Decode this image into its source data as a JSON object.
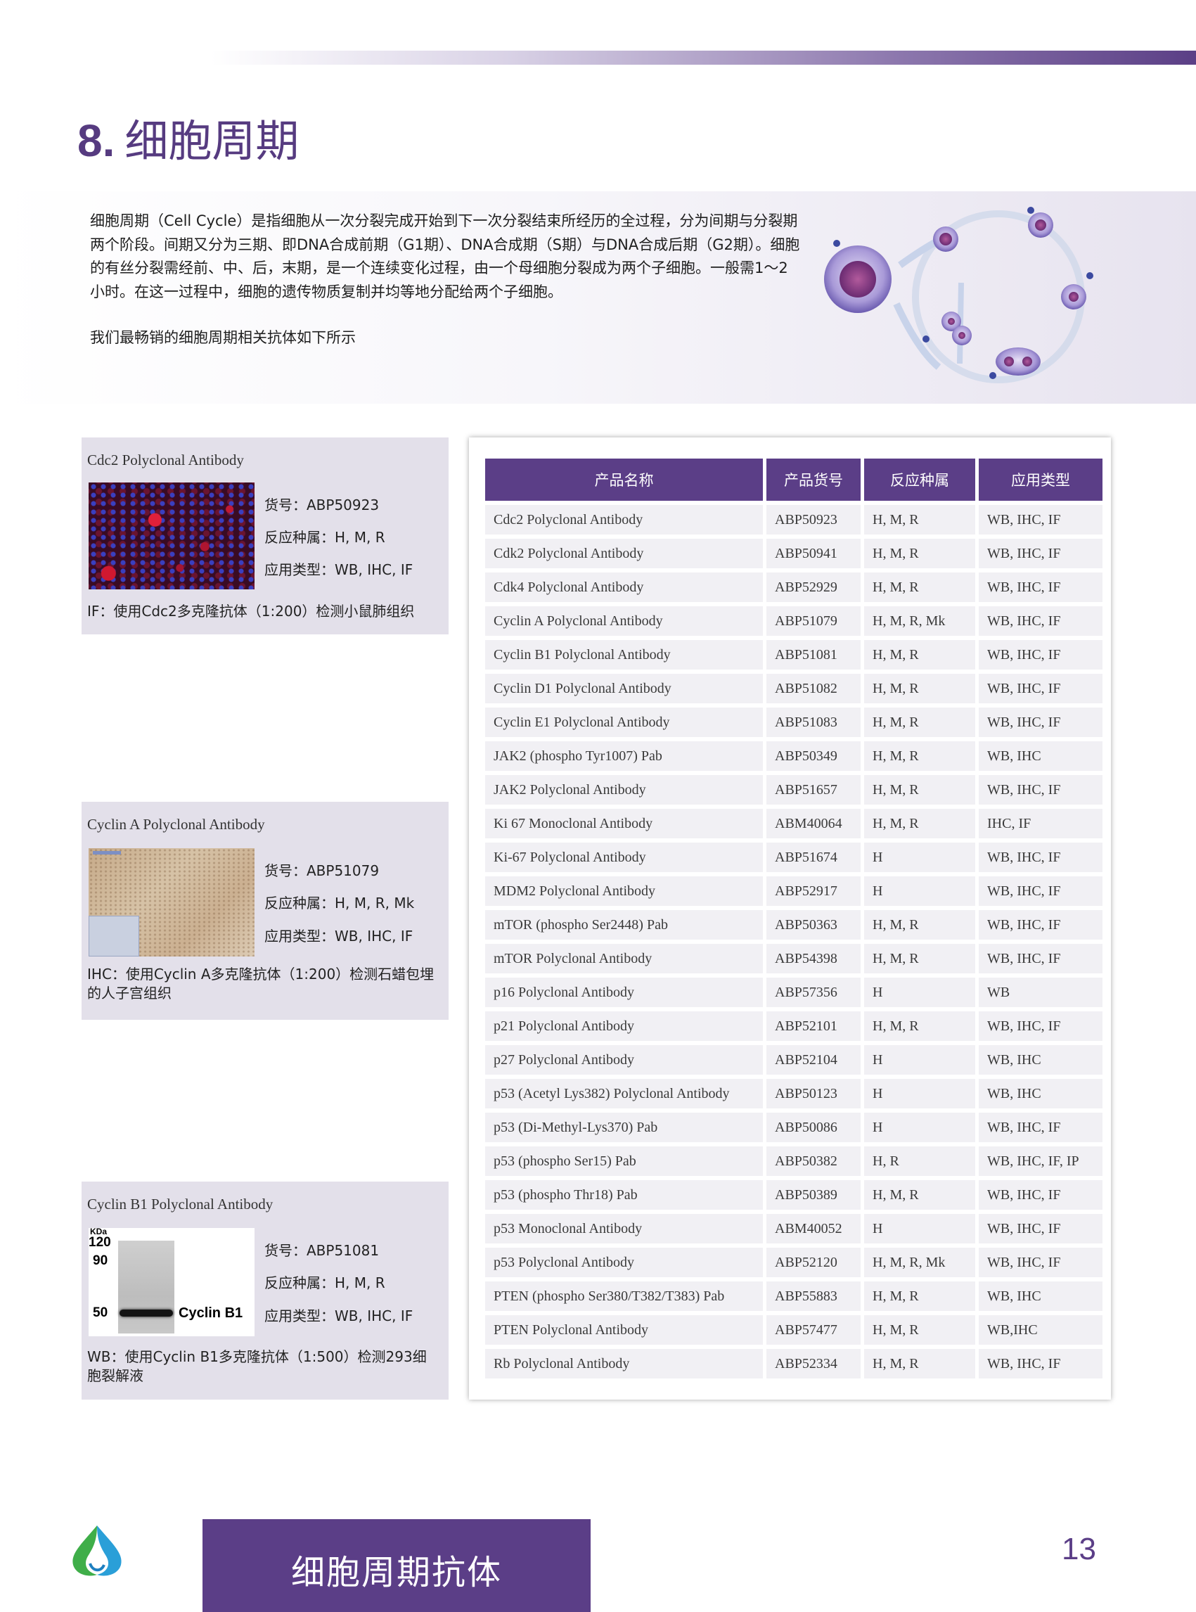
{
  "header": {
    "section_number": "8.",
    "title": "细胞周期"
  },
  "intro": {
    "paragraph": "细胞周期（Cell Cycle）是指细胞从一次分裂完成开始到下一次分裂结束所经历的全过程，分为间期与分裂期两个阶段。间期又分为三期、即DNA合成前期（G1期）、DNA合成期（S期）与DNA合成后期（G2期）。细胞的有丝分裂需经前、中、后，末期，是一个连续变化过程，由一个母细胞分裂成为两个子细胞。一般需1～2小时。在这一过程中，细胞的遗传物质复制并均等地分配给两个子细胞。",
    "note": "我们最畅销的细胞周期相关抗体如下所示"
  },
  "samples": [
    {
      "title": "Cdc2 Polyclonal Antibody",
      "catalog": "货号：ABP50923",
      "reactivity": "反应种属：H, M, R",
      "application": "应用类型：WB, IHC, IF",
      "caption": "IF：使用Cdc2多克隆抗体（1:200）检测小鼠肺组织"
    },
    {
      "title": "Cyclin A Polyclonal Antibody",
      "catalog": "货号：ABP51079",
      "reactivity": "反应种属：H, M, R, Mk",
      "application": "应用类型：WB, IHC, IF",
      "caption": "IHC：使用Cyclin A多克隆抗体（1:200）检测石蜡包埋的人子宫组织"
    },
    {
      "title": "Cyclin B1 Polyclonal Antibody",
      "catalog": "货号：ABP51081",
      "reactivity": "反应种属：H, M, R",
      "application": "应用类型：WB, IHC, IF",
      "caption": "WB：使用Cyclin B1多克隆抗体（1:500）检测293细胞裂解液",
      "blot": {
        "unit": "KDa",
        "markers": [
          "120",
          "90",
          "50"
        ],
        "band_label": "Cyclin B1"
      }
    }
  ],
  "table": {
    "headers": [
      "产品名称",
      "产品货号",
      "反应种属",
      "应用类型"
    ],
    "rows": [
      [
        "Cdc2 Polyclonal Antibody",
        "ABP50923",
        "H, M, R",
        "WB, IHC, IF"
      ],
      [
        "Cdk2 Polyclonal Antibody",
        "ABP50941",
        "H, M, R",
        "WB, IHC, IF"
      ],
      [
        "Cdk4 Polyclonal Antibody",
        "ABP52929",
        "H, M, R",
        "WB, IHC, IF"
      ],
      [
        "Cyclin A Polyclonal Antibody",
        "ABP51079",
        "H, M, R, Mk",
        "WB, IHC, IF"
      ],
      [
        "Cyclin B1 Polyclonal Antibody",
        "ABP51081",
        "H, M, R",
        "WB, IHC, IF"
      ],
      [
        "Cyclin D1 Polyclonal Antibody",
        "ABP51082",
        "H, M, R",
        "WB, IHC, IF"
      ],
      [
        "Cyclin E1 Polyclonal Antibody",
        "ABP51083",
        "H, M, R",
        "WB, IHC, IF"
      ],
      [
        "JAK2 (phospho Tyr1007) Pab",
        "ABP50349",
        "H, M, R",
        "WB, IHC"
      ],
      [
        "JAK2 Polyclonal Antibody",
        "ABP51657",
        "H, M, R",
        "WB, IHC, IF"
      ],
      [
        "Ki 67 Monoclonal Antibody",
        "ABM40064",
        "H, M, R",
        "IHC, IF"
      ],
      [
        "Ki-67 Polyclonal Antibody",
        "ABP51674",
        "H",
        "WB, IHC, IF"
      ],
      [
        "MDM2 Polyclonal Antibody",
        "ABP52917",
        "H",
        "WB, IHC, IF"
      ],
      [
        "mTOR (phospho Ser2448) Pab",
        "ABP50363",
        "H, M, R",
        "WB, IHC, IF"
      ],
      [
        "mTOR Polyclonal Antibody",
        "ABP54398",
        "H, M, R",
        "WB, IHC, IF"
      ],
      [
        "p16 Polyclonal Antibody",
        "ABP57356",
        "H",
        "WB"
      ],
      [
        "p21 Polyclonal Antibody",
        "ABP52101",
        "H, M, R",
        "WB, IHC, IF"
      ],
      [
        "p27 Polyclonal Antibody",
        "ABP52104",
        "H",
        "WB, IHC"
      ],
      [
        "p53 (Acetyl Lys382) Polyclonal Antibody",
        "ABP50123",
        "H",
        "WB, IHC"
      ],
      [
        "p53 (Di-Methyl-Lys370) Pab",
        "ABP50086",
        "H",
        "WB, IHC, IF"
      ],
      [
        "p53 (phospho Ser15) Pab",
        "ABP50382",
        "H, R",
        "WB, IHC, IF, IP"
      ],
      [
        "p53 (phospho Thr18) Pab",
        "ABP50389",
        "H, M, R",
        "WB, IHC, IF"
      ],
      [
        "p53 Monoclonal Antibody",
        "ABM40052",
        "H",
        "WB, IHC, IF"
      ],
      [
        "p53 Polyclonal Antibody",
        "ABP52120",
        "H, M, R, Mk",
        "WB, IHC, IF"
      ],
      [
        "PTEN (phospho Ser380/T382/T383) Pab",
        "ABP55883",
        "H, M, R",
        "WB, IHC"
      ],
      [
        "PTEN Polyclonal Antibody",
        "ABP57477",
        "H, M, R",
        "WB,IHC"
      ],
      [
        "Rb Polyclonal Antibody",
        "ABP52334",
        "H, M, R",
        "WB, IHC, IF"
      ]
    ]
  },
  "footer": {
    "band_title": "细胞周期抗体",
    "page_number": "13"
  },
  "colors": {
    "brand_purple": "#5b3e87",
    "cell_fill": "#f1f0f4",
    "sample_bg": "#e3e0ea"
  }
}
